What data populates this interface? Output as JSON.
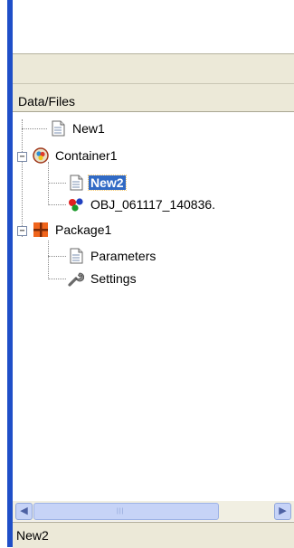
{
  "panel": {
    "header_title": "Data/Files",
    "status_text": "New2"
  },
  "tree": {
    "items": [
      {
        "label": "New1",
        "icon": "document-icon",
        "level": 1,
        "selected": false
      },
      {
        "label": "Container1",
        "icon": "container-icon",
        "level": 1,
        "expanded": true
      },
      {
        "label": "New2",
        "icon": "document-icon",
        "level": 2,
        "selected": true
      },
      {
        "label": "OBJ_061117_140836.",
        "icon": "molecule-icon",
        "level": 2,
        "selected": false
      },
      {
        "label": "Package1",
        "icon": "package-icon",
        "level": 1,
        "expanded": true
      },
      {
        "label": "Parameters",
        "icon": "document-icon",
        "level": 2,
        "selected": false
      },
      {
        "label": "Settings",
        "icon": "wrench-icon",
        "level": 2,
        "selected": false
      }
    ],
    "toggle_glyph": "−"
  },
  "scrollbar": {
    "left_arrow": "◀",
    "right_arrow": "▶",
    "grip": "|||"
  },
  "colors": {
    "frame_blue": "#1f4fc8",
    "selection": "#316ac5",
    "chrome": "#ece9d8"
  }
}
